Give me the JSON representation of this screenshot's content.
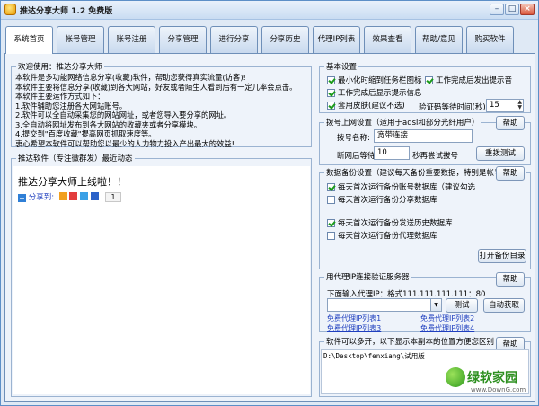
{
  "window": {
    "title": "推达分享大师 1.2 免费版"
  },
  "tabs": [
    "系统首页",
    "帐号管理",
    "账号注册",
    "分享管理",
    "进行分享",
    "分享历史",
    "代理IP列表",
    "效果查看",
    "帮助/意见",
    "购买软件"
  ],
  "welcome": {
    "title": "欢迎使用：推达分享大师",
    "lines": [
      "本软件是多功能网络信息分享(收藏)软件，帮助您获得真实流量(访客)!",
      "本软件主要将信息分享(收藏)到各大网站，好友或者陌生人看到后有一定几率会点击。",
      "本软件主要运作方式如下：",
      "1.软件辅助您注册各大网站账号。",
      "2.软件可以全自动采集您的网站网址，或者您导入要分享的网址。",
      "3.全自动将网址发布到各大网站的收藏夹或者分享模块。",
      "4.提交到\"百度收藏\"提高网页抓取速度等。",
      "衷心希望本软件可以帮助您以最少的人力物力投入产出最大的效益!"
    ]
  },
  "news": {
    "title": "推达软件（专注微群发）最近动态",
    "headline": "推达分享大师上线啦！！",
    "share_label": "分享到:",
    "share_count": "1"
  },
  "basic": {
    "title": "基本设置",
    "opt1": "最小化时缩到任务栏图标",
    "opt2": "工作完成后发出提示音",
    "opt3": "工作完成后显示提示信息",
    "opt4": "套用皮肤(建议不选)",
    "timeout_label": "验证码等待时间(秒)",
    "timeout_value": "15"
  },
  "dial": {
    "title": "拨号上网设置（适用于adsl和部分光纤用户）",
    "help": "帮助",
    "name_label": "拨号名称:",
    "name_value": "宽带连接",
    "wait_label": "断网后等待",
    "wait_value": "10",
    "wait_suffix": "秒再尝试拔号",
    "test_button": "重拨测试"
  },
  "backup": {
    "title": "数据备份设置（建议每天备份重要数据，特别是帐号数据）",
    "help": "帮助",
    "opt1": "每天首次运行备份账号数据库（建议勾选",
    "opt2": "每天首次运行备份分享数据库",
    "opt3": "每天首次运行备份发送历史数据库",
    "opt4": "每天首次运行备份代理数据库",
    "open_button": "打开备份目录"
  },
  "proxy": {
    "title": "用代理IP连接验证服务器",
    "help": "帮助",
    "input_label": "下面输入代理IP：格式111.111.111.111：80",
    "test_button": "测试",
    "auto_button": "自动获取",
    "links": [
      "免费代理IP列表1",
      "免费代理IP列表2",
      "免费代理IP列表3",
      "免费代理IP列表4"
    ]
  },
  "path": {
    "title": "软件可以多开，以下显示本副本的位置方便您区别",
    "help": "帮助",
    "value": "D:\\Desktop\\fenxiang\\试用版"
  },
  "watermark": {
    "brand": "绿软家园",
    "url": "www.DownG.com"
  }
}
